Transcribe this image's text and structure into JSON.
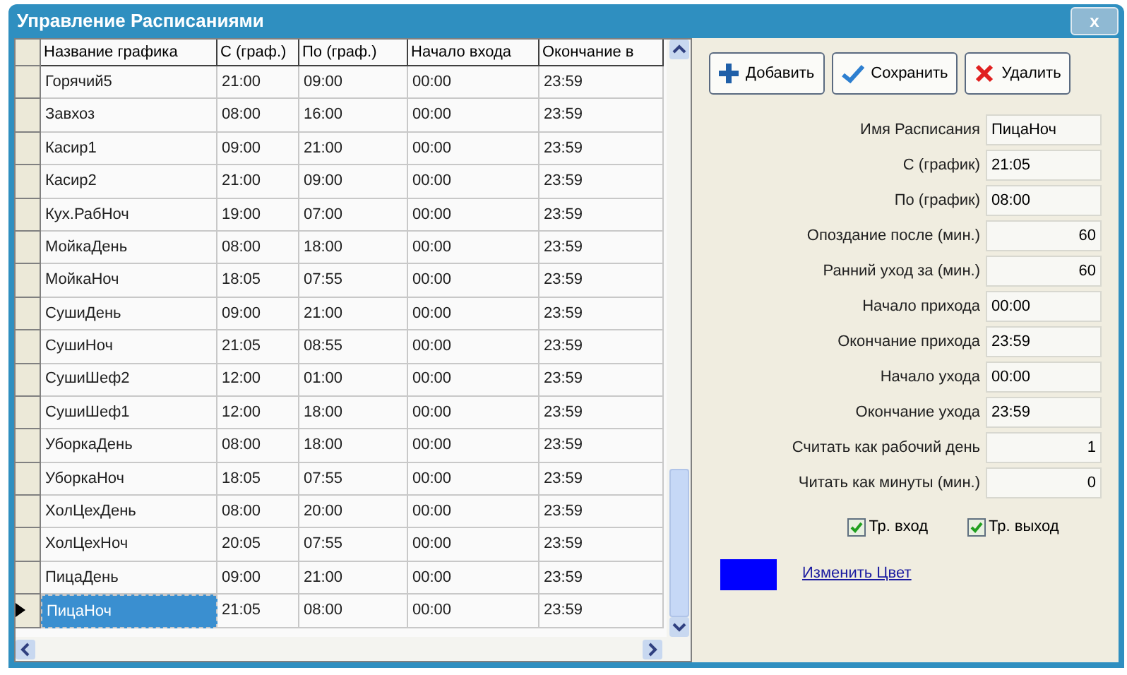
{
  "window": {
    "title": "Управление Расписаниями",
    "close": "x"
  },
  "table": {
    "columns": [
      "Название графика",
      "С (граф.)",
      "По (граф.)",
      "Начало входа",
      "Окончание в"
    ],
    "rows": [
      {
        "cells": [
          "Горячий5",
          "21:00",
          "09:00",
          "00:00",
          "23:59"
        ],
        "selected": false
      },
      {
        "cells": [
          "Завхоз",
          "08:00",
          "16:00",
          "00:00",
          "23:59"
        ],
        "selected": false
      },
      {
        "cells": [
          "Касир1",
          "09:00",
          "21:00",
          "00:00",
          "23:59"
        ],
        "selected": false
      },
      {
        "cells": [
          "Касир2",
          "21:00",
          "09:00",
          "00:00",
          "23:59"
        ],
        "selected": false
      },
      {
        "cells": [
          "Кух.РабНоч",
          "19:00",
          "07:00",
          "00:00",
          "23:59"
        ],
        "selected": false
      },
      {
        "cells": [
          "МойкаДень",
          "08:00",
          "18:00",
          "00:00",
          "23:59"
        ],
        "selected": false
      },
      {
        "cells": [
          "МойкаНоч",
          "18:05",
          "07:55",
          "00:00",
          "23:59"
        ],
        "selected": false
      },
      {
        "cells": [
          "СушиДень",
          "09:00",
          "21:00",
          "00:00",
          "23:59"
        ],
        "selected": false
      },
      {
        "cells": [
          "СушиНоч",
          "21:05",
          "08:55",
          "00:00",
          "23:59"
        ],
        "selected": false
      },
      {
        "cells": [
          "СушиШеф2",
          "12:00",
          "01:00",
          "00:00",
          "23:59"
        ],
        "selected": false
      },
      {
        "cells": [
          "СушиШеф1",
          "12:00",
          "18:00",
          "00:00",
          "23:59"
        ],
        "selected": false
      },
      {
        "cells": [
          "УборкаДень",
          "08:00",
          "18:00",
          "00:00",
          "23:59"
        ],
        "selected": false
      },
      {
        "cells": [
          "УборкаНоч",
          "18:05",
          "07:55",
          "00:00",
          "23:59"
        ],
        "selected": false
      },
      {
        "cells": [
          "ХолЦехДень",
          "08:00",
          "20:00",
          "00:00",
          "23:59"
        ],
        "selected": false
      },
      {
        "cells": [
          "ХолЦехНоч",
          "20:05",
          "07:55",
          "00:00",
          "23:59"
        ],
        "selected": false
      },
      {
        "cells": [
          "ПицаДень",
          "09:00",
          "21:00",
          "00:00",
          "23:59"
        ],
        "selected": false
      },
      {
        "cells": [
          "ПицаНоч",
          "21:05",
          "08:00",
          "00:00",
          "23:59"
        ],
        "selected": true
      }
    ]
  },
  "toolbar": [
    {
      "kind": "add",
      "label": "Добавить"
    },
    {
      "kind": "save",
      "label": "Сохранить"
    },
    {
      "kind": "delete",
      "label": "Удалить"
    }
  ],
  "form": [
    {
      "label": "Имя Расписания",
      "value": "ПицаНоч",
      "kind": "text"
    },
    {
      "label": "С (график)",
      "value": "21:05",
      "kind": "text"
    },
    {
      "label": "По (график)",
      "value": "08:00",
      "kind": "text"
    },
    {
      "label": "Опоздание после (мин.)",
      "value": "60",
      "kind": "number"
    },
    {
      "label": "Ранний уход за (мин.)",
      "value": "60",
      "kind": "number"
    },
    {
      "label": "Начало прихода",
      "value": "00:00",
      "kind": "text"
    },
    {
      "label": "Окончание прихода",
      "value": "23:59",
      "kind": "text"
    },
    {
      "label": "Начало ухода",
      "value": "00:00",
      "kind": "text"
    },
    {
      "label": "Окончание ухода",
      "value": "23:59",
      "kind": "text"
    },
    {
      "label": "Считать как рабочий день",
      "value": "1",
      "kind": "number"
    },
    {
      "label": "Читать как минуты (мин.)",
      "value": "0",
      "kind": "number"
    }
  ],
  "checkboxes": [
    {
      "label": "Тр. вход",
      "checked": true
    },
    {
      "label": "Тр. выход",
      "checked": true
    }
  ],
  "color": {
    "color": "#0000ff",
    "link": "Изменить Цвет"
  }
}
